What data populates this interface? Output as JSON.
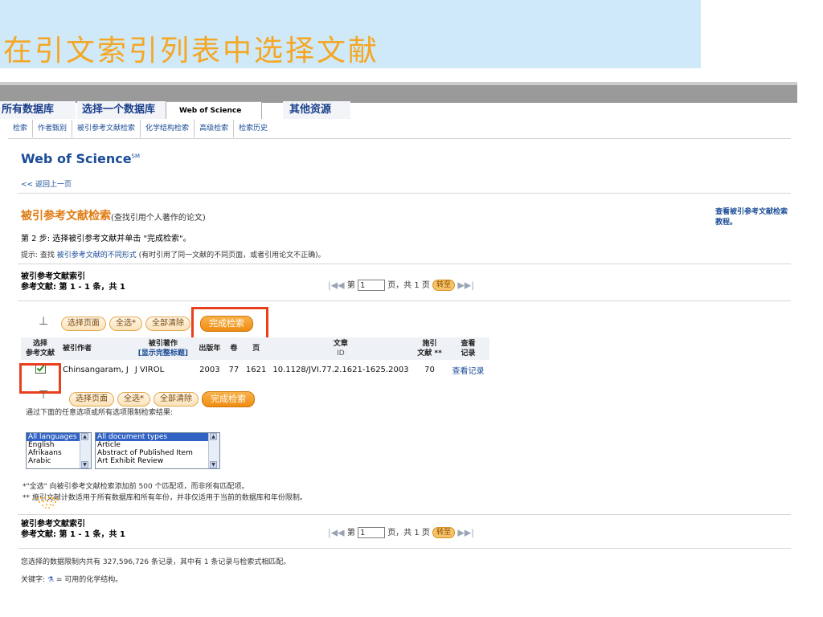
{
  "slide": {
    "title": "在引文索引列表中选择文献"
  },
  "db_tabs": [
    "所有数据库",
    "选择一个数据库",
    "Web of Science",
    "其他资源"
  ],
  "subnav": [
    "检索",
    "作者甄别",
    "被引参考文献检索",
    "化学结构检索",
    "高级检索",
    "检索历史"
  ],
  "header": {
    "product": "Web of Science",
    "sm": "SM",
    "back": "<< 返回上一页"
  },
  "section": {
    "title": "被引参考文献检索",
    "subtitle": "(查找引用个人著作的论文)",
    "tutorial": "查看被引参考文献检索教程。",
    "step": "第 2 步: 选择被引参考文献并单击 \"完成检索\"。",
    "tip_prefix": "提示: 查找 ",
    "tip_link": "被引参考文献的不同形式",
    "tip_suffix": " (有时引用了同一文献的不同页面，或者引用论文不正确)。"
  },
  "index": {
    "label": "被引参考文献索引",
    "count": "参考文献: 第 1 - 1 条，共 1"
  },
  "pager": {
    "prefix": "第",
    "page": "1",
    "suffix": "页，共 1 页",
    "go": "转至"
  },
  "buttons": {
    "select_page": "选择页面",
    "select_all": "全选*",
    "clear_all": "全部清除",
    "finish": "完成检索"
  },
  "table": {
    "headers": {
      "select": "选择\n参考文献",
      "author": "被引作者",
      "work": "被引著作",
      "work_link": "[显示完整标题]",
      "year": "出版年",
      "vol": "卷",
      "page": "页",
      "article": "文章",
      "article_sub": "ID",
      "cites": "施引\n文献 **",
      "view": "查看\n记录"
    },
    "rows": [
      {
        "author": "Chinsangaram, J",
        "work": "J VIROL",
        "year": "2003",
        "vol": "77",
        "page": "1621",
        "article": "10.1128/JVI.77.2.1621-1625.2003",
        "cites": "70",
        "view": "查看记录"
      }
    ]
  },
  "filter": {
    "label": "通过下面的任意选项或所有选项限制检索结果:",
    "languages": [
      "All languages",
      "English",
      "Afrikaans",
      "Arabic"
    ],
    "doc_types": [
      "All document types",
      "Article",
      "Abstract of Published Item",
      "Art Exhibit Review"
    ]
  },
  "notes": [
    "*\"全选\" 向被引参考文献检索添加前 500 个匹配项，而非所有匹配项。",
    "** 施引文献计数适用于所有数据库和所有年份，并非仅适用于当前的数据库和年份限制。"
  ],
  "footer": {
    "records": "您选择的数据限制内共有 327,596,726 条记录，其中有 1 条记录与检索式相匹配。",
    "key_prefix": "关键字: ",
    "key_suffix": " = 可用的化学结构。"
  }
}
